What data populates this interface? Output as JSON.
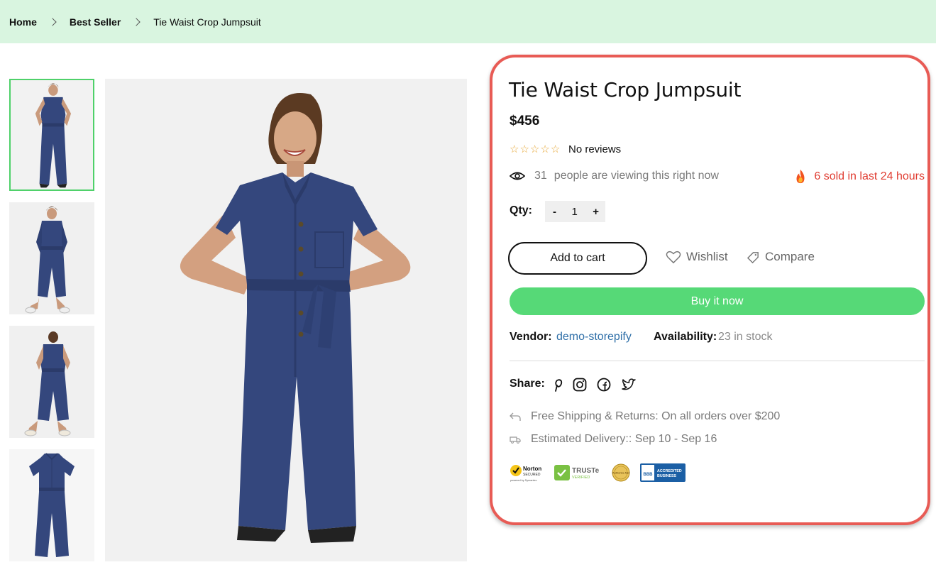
{
  "breadcrumb": {
    "items": [
      "Home",
      "Best Seller",
      "Tie Waist Crop Jumpsuit"
    ]
  },
  "product": {
    "title": "Tie Waist Crop Jumpsuit",
    "price": "$456",
    "rating": 0,
    "rating_max": 5,
    "reviews_text": "No reviews",
    "viewing_count": "31",
    "viewing_text": "people are viewing this right now",
    "sold_text": "6 sold in last 24 hours",
    "qty_label": "Qty:",
    "qty_value": "1",
    "qty_minus": "-",
    "qty_plus": "+",
    "add_to_cart": "Add to cart",
    "wishlist": "Wishlist",
    "compare": "Compare",
    "buy_now": "Buy it now",
    "vendor_label": "Vendor:",
    "vendor_value": "demo-storepify",
    "availability_label": "Availability:",
    "availability_value": "23 in stock",
    "share_label": "Share:",
    "share_icons": [
      "pinterest-icon",
      "instagram-icon",
      "facebook-icon",
      "twitter-icon"
    ],
    "shipping_text": "Free Shipping & Returns: On all orders over $200",
    "delivery_text": "Estimated Delivery:: Sep 10 - Sep 16",
    "trust_badges": [
      {
        "name": "Norton",
        "line1": "Norton",
        "line2": "SECURED",
        "line3": "powered by Symantec"
      },
      {
        "name": "TRUSTe",
        "line1": "TRUSTe",
        "line2": "VERIFIED"
      },
      {
        "name": "Authorize.Net",
        "line1": "Authorize.Net"
      },
      {
        "name": "BBB",
        "line1": "BBB",
        "line2": "ACCREDITED",
        "line3": "BUSINESS"
      }
    ]
  },
  "gallery": {
    "active_thumb": 0,
    "thumb_count": 4
  },
  "colors": {
    "breadcrumb_bg": "#d9f5e0",
    "accent_green": "#56d977",
    "thumb_active_border": "#4fd16a",
    "sold_red": "#e03c31",
    "vendor_link": "#2f6fa8",
    "highlight_border": "#e85b55",
    "denim": "#34477d",
    "star": "#e7a93a"
  }
}
